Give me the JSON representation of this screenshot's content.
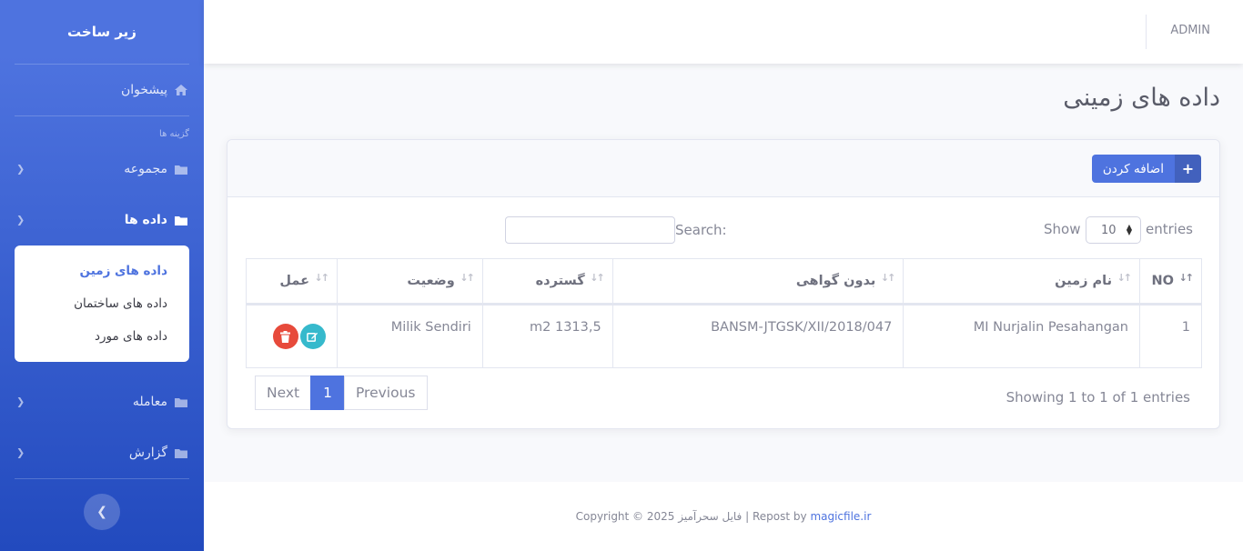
{
  "sidebar": {
    "brand": "زیر ساخت",
    "dashboard": "پیشخوان",
    "heading": "گزینه ها",
    "collection": "مجموعه",
    "data": "داده ها",
    "submenu": [
      "داده های زمین",
      "داده های ساختمان",
      "داده های مورد"
    ],
    "transaction": "معامله",
    "report": "گزارش"
  },
  "topbar": {
    "user": "ADMIN"
  },
  "page": {
    "title": "داده های زمینی"
  },
  "card": {
    "add_label": "اضافه کردن",
    "show_label": "Show",
    "entries_label": "entries",
    "length_value": "10",
    "search_label": "Search:",
    "columns": [
      "NO",
      "نام زمین",
      "بدون گواهی",
      "گسترده",
      "وضعیت",
      "عمل"
    ],
    "rows": [
      {
        "no": "1",
        "name": "MI Nurjalin Pesahangan",
        "certificate": "BANSM-JTGSK/XII/2018/047",
        "area": "m2 1313,5",
        "status": "Milik Sendiri"
      }
    ],
    "info": "Showing 1 to 1 of 1 entries",
    "pager": {
      "next": "Next",
      "current": "1",
      "previous": "Previous"
    }
  },
  "footer": {
    "text": "Copyright © 2025 فایل سحرآمیز | Repost by ",
    "link": "magicfile.ir"
  }
}
